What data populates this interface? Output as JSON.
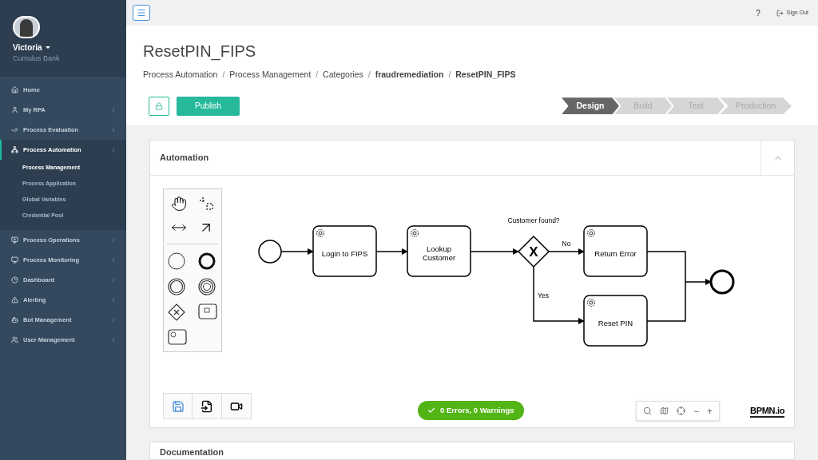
{
  "user": {
    "name": "Victoria",
    "organization": "Cumulus Bank"
  },
  "sidebar": {
    "items": [
      {
        "label": "Home",
        "expandable": false,
        "selected": false
      },
      {
        "label": "My RPA",
        "expandable": true,
        "selected": false
      },
      {
        "label": "Process Evaluation",
        "expandable": true,
        "selected": false
      },
      {
        "label": "Process Automation",
        "expandable": true,
        "selected": true,
        "expanded": true,
        "children": [
          {
            "label": "Process Management",
            "selected": true
          },
          {
            "label": "Process Application",
            "selected": false
          },
          {
            "label": "Global Variables",
            "selected": false
          },
          {
            "label": "Credential Pool",
            "selected": false
          }
        ]
      },
      {
        "label": "Process Operations",
        "expandable": true,
        "selected": false
      },
      {
        "label": "Process Monitoring",
        "expandable": true,
        "selected": false
      },
      {
        "label": "Dashboard",
        "expandable": true,
        "selected": false
      },
      {
        "label": "Alerting",
        "expandable": true,
        "selected": false
      },
      {
        "label": "Bot Management",
        "expandable": true,
        "selected": false
      },
      {
        "label": "User Management",
        "expandable": true,
        "selected": false
      }
    ]
  },
  "topbar": {
    "help": "?",
    "sign_out": "Sign Out"
  },
  "page": {
    "title": "ResetPIN_FIPS",
    "breadcrumbs": [
      {
        "label": "Process Automation",
        "current": false
      },
      {
        "label": "Process Management",
        "current": false,
        "separator": "/"
      },
      {
        "label": "Categories",
        "current": false,
        "separator": "/"
      },
      {
        "label": "fraudremediation",
        "current": true,
        "separator": "/"
      },
      {
        "label": "ResetPIN_FIPS",
        "current": true,
        "separator": "/"
      }
    ]
  },
  "actions": {
    "publish": "Publish"
  },
  "stages": [
    {
      "label": "Design",
      "selected": true
    },
    {
      "label": "Build",
      "selected": false
    },
    {
      "label": "Test",
      "selected": false
    },
    {
      "label": "Production",
      "selected": false
    }
  ],
  "automation": {
    "title": "Automation",
    "expanded": true,
    "diagram": {
      "tasks": [
        "Login to FIPS",
        "Lookup Customer",
        "Return Error",
        "Reset PIN"
      ],
      "gateway_label": "Customer found?",
      "gateway_symbol": "X",
      "flow_labels": [
        "No",
        "Yes"
      ]
    },
    "validation": "0 Errors, 0 Warnings",
    "zoom_out": "−",
    "zoom_in": "+",
    "logo": "BPMN.io"
  },
  "documentation": {
    "title": "Documentation"
  }
}
